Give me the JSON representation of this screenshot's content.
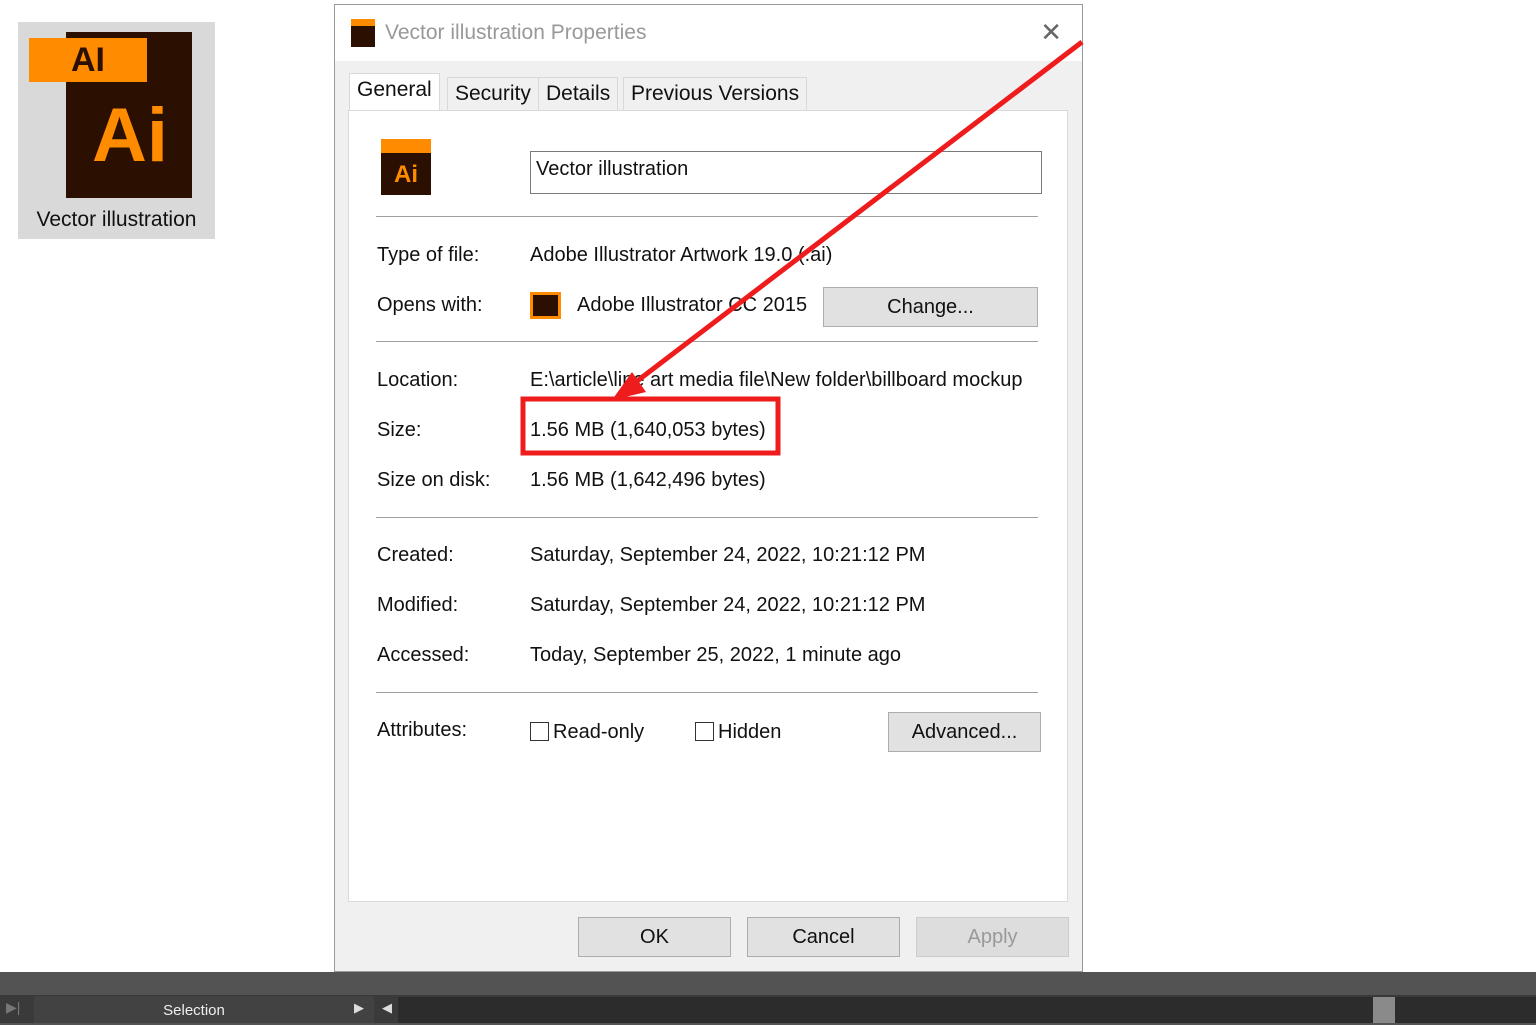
{
  "desktop": {
    "icon_label": "Vector illustration",
    "icon_badge": "AI",
    "icon_text": "Ai"
  },
  "dialog": {
    "title": "Vector illustration Properties",
    "tabs": [
      "General",
      "Security",
      "Details",
      "Previous Versions"
    ],
    "name_value": "Vector illustration",
    "rows": [
      {
        "label": "Type of file:",
        "value": "Adobe Illustrator Artwork 19.0 (.ai)"
      },
      {
        "label": "Opens with:",
        "value": "Adobe Illustrator CC 2015"
      },
      {
        "label": "Location:",
        "value": "E:\\article\\line art media file\\New folder\\billboard mockup"
      },
      {
        "label": "Size:",
        "value": "1.56 MB (1,640,053 bytes)"
      },
      {
        "label": "Size on disk:",
        "value": "1.56 MB (1,642,496 bytes)"
      },
      {
        "label": "Created:",
        "value": "Saturday, September 24, 2022, 10:21:12 PM"
      },
      {
        "label": "Modified:",
        "value": "Saturday, September 24, 2022, 10:21:12 PM"
      },
      {
        "label": "Accessed:",
        "value": "Today, September 25, 2022, 1 minute ago"
      },
      {
        "label": "Attributes:"
      }
    ],
    "change_label": "Change...",
    "readonly_label": "Read-only",
    "hidden_label": "Hidden",
    "advanced_label": "Advanced...",
    "ok_label": "OK",
    "cancel_label": "Cancel",
    "apply_label": "Apply"
  },
  "taskbar": {
    "selection_label": "Selection"
  },
  "annotation_color": "#ee1c1c"
}
